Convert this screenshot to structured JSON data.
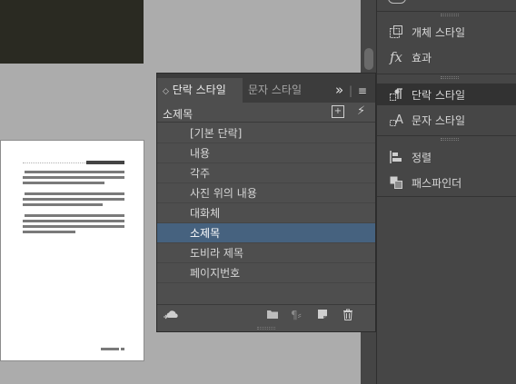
{
  "panel": {
    "tabs": [
      {
        "label": "단락 스타일",
        "active": true
      },
      {
        "label": "문자 스타일",
        "active": false
      }
    ],
    "expand_glyph": "»",
    "menu_glyph": "≡",
    "current_style": "소제목",
    "styles": [
      {
        "label": "[기본 단락]",
        "selected": false
      },
      {
        "label": "내용",
        "selected": false
      },
      {
        "label": "각주",
        "selected": false
      },
      {
        "label": "사진 위의 내용",
        "selected": false
      },
      {
        "label": "대화체",
        "selected": false
      },
      {
        "label": "소제목",
        "selected": true
      },
      {
        "label": "도비라 제목",
        "selected": false
      },
      {
        "label": "페이지번호",
        "selected": false
      }
    ],
    "bottom_icons": [
      "cc-library-icon",
      "folder-icon",
      "clear-override-icon",
      "new-style-icon",
      "trash-icon"
    ]
  },
  "dock": {
    "items": [
      {
        "label": "개체 스타일",
        "icon": "object-styles-icon"
      },
      {
        "label": "효과",
        "icon": "fx-icon"
      },
      {
        "label": "단락 스타일",
        "icon": "paragraph-styles-icon",
        "active": true
      },
      {
        "label": "문자 스타일",
        "icon": "character-styles-icon"
      },
      {
        "label": "정렬",
        "icon": "align-icon"
      },
      {
        "label": "패스파인더",
        "icon": "pathfinder-icon"
      }
    ]
  },
  "colors": {
    "selection": "#46627f",
    "panel_bg": "#4e4e4e",
    "dock_bg": "#464646",
    "pasteboard": "#acacac"
  }
}
